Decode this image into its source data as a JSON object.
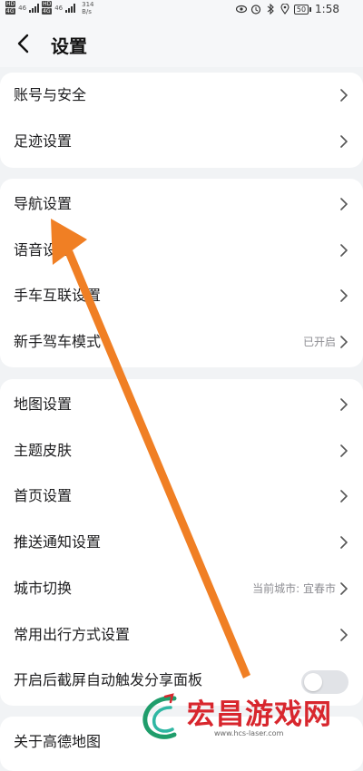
{
  "status_bar": {
    "sim1": "HD",
    "sim1b": "4G",
    "sim2": "HD",
    "sim2b": "4G",
    "net_a": "46",
    "net_b": "46",
    "speed": "314",
    "speed_unit": "B/s",
    "battery": "50",
    "time": "1:58"
  },
  "header": {
    "title": "设置"
  },
  "groups": [
    {
      "items": [
        {
          "label": "账号与安全"
        },
        {
          "label": "足迹设置"
        }
      ]
    },
    {
      "items": [
        {
          "label": "导航设置"
        },
        {
          "label": "语音设置"
        },
        {
          "label": "手车互联设置"
        },
        {
          "label": "新手驾车模式",
          "value": "已开启"
        }
      ]
    },
    {
      "items": [
        {
          "label": "地图设置"
        },
        {
          "label": "主题皮肤"
        },
        {
          "label": "首页设置"
        },
        {
          "label": "推送通知设置"
        },
        {
          "label": "城市切换",
          "value": "当前城市: 宜春市"
        },
        {
          "label": "常用出行方式设置"
        },
        {
          "label": "开启后截屏自动触发分享面板",
          "toggle": false
        }
      ]
    },
    {
      "items": [
        {
          "label": "关于高德地图"
        }
      ]
    }
  ],
  "annotation_arrow": {
    "color": "#f07f24"
  },
  "watermark": {
    "text": "宏昌游戏网",
    "url": "www.hcs-laser.com",
    "color": "#d8262d"
  }
}
